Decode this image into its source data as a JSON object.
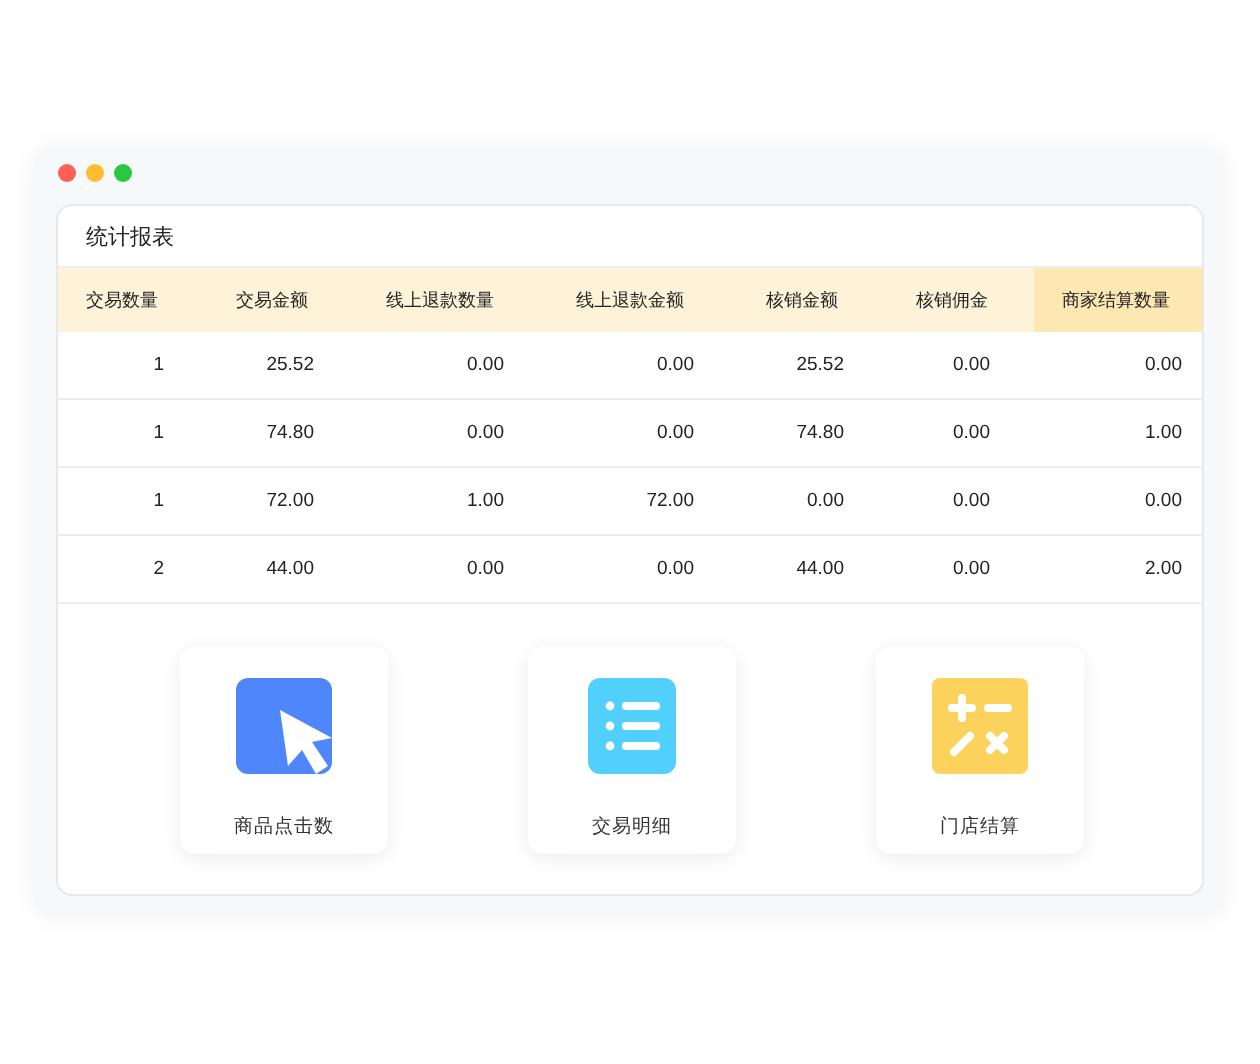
{
  "window": {
    "controls": [
      {
        "color": "#fe5f57"
      },
      {
        "color": "#febc2e"
      },
      {
        "color": "#28c840"
      }
    ]
  },
  "panel": {
    "title": "统计报表"
  },
  "table": {
    "columns": [
      {
        "label": "交易数量",
        "selected": false
      },
      {
        "label": "交易金额",
        "selected": false
      },
      {
        "label": "线上退款数量",
        "selected": false
      },
      {
        "label": "线上退款金额",
        "selected": false
      },
      {
        "label": "核销金额",
        "selected": false
      },
      {
        "label": "核销佣金",
        "selected": false
      },
      {
        "label": "商家结算数量",
        "selected": true
      }
    ],
    "rows": [
      [
        "1",
        "25.52",
        "0.00",
        "0.00",
        "25.52",
        "0.00",
        "0.00"
      ],
      [
        "1",
        "74.80",
        "0.00",
        "0.00",
        "74.80",
        "0.00",
        "1.00"
      ],
      [
        "1",
        "72.00",
        "1.00",
        "72.00",
        "0.00",
        "0.00",
        "0.00"
      ],
      [
        "2",
        "44.00",
        "0.00",
        "0.00",
        "44.00",
        "0.00",
        "2.00"
      ]
    ]
  },
  "shortcuts": [
    {
      "kind": "pointer",
      "label": "商品点击数"
    },
    {
      "kind": "list",
      "label": "交易明细"
    },
    {
      "kind": "calculator",
      "label": "门店结算"
    }
  ]
}
